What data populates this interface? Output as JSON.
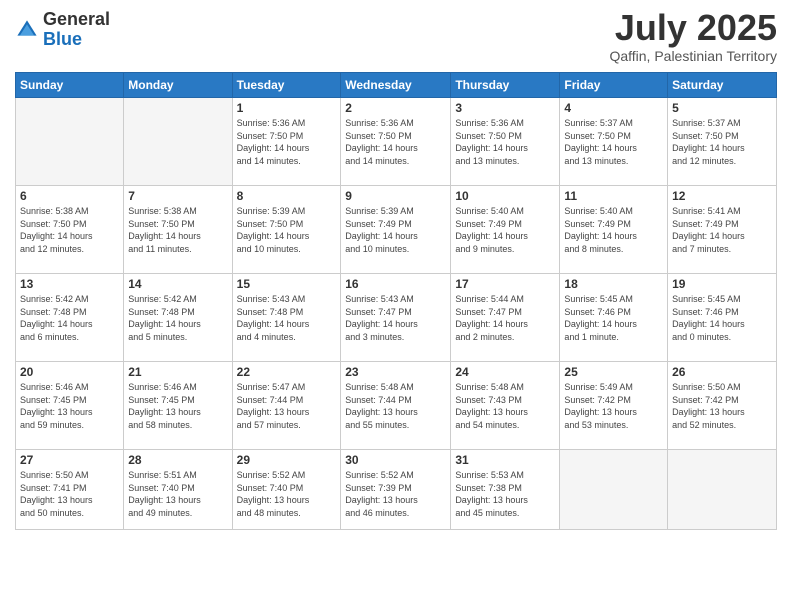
{
  "logo": {
    "general": "General",
    "blue": "Blue"
  },
  "header": {
    "month": "July 2025",
    "location": "Qaffin, Palestinian Territory"
  },
  "weekdays": [
    "Sunday",
    "Monday",
    "Tuesday",
    "Wednesday",
    "Thursday",
    "Friday",
    "Saturday"
  ],
  "weeks": [
    [
      {
        "day": "",
        "info": ""
      },
      {
        "day": "",
        "info": ""
      },
      {
        "day": "1",
        "info": "Sunrise: 5:36 AM\nSunset: 7:50 PM\nDaylight: 14 hours\nand 14 minutes."
      },
      {
        "day": "2",
        "info": "Sunrise: 5:36 AM\nSunset: 7:50 PM\nDaylight: 14 hours\nand 14 minutes."
      },
      {
        "day": "3",
        "info": "Sunrise: 5:36 AM\nSunset: 7:50 PM\nDaylight: 14 hours\nand 13 minutes."
      },
      {
        "day": "4",
        "info": "Sunrise: 5:37 AM\nSunset: 7:50 PM\nDaylight: 14 hours\nand 13 minutes."
      },
      {
        "day": "5",
        "info": "Sunrise: 5:37 AM\nSunset: 7:50 PM\nDaylight: 14 hours\nand 12 minutes."
      }
    ],
    [
      {
        "day": "6",
        "info": "Sunrise: 5:38 AM\nSunset: 7:50 PM\nDaylight: 14 hours\nand 12 minutes."
      },
      {
        "day": "7",
        "info": "Sunrise: 5:38 AM\nSunset: 7:50 PM\nDaylight: 14 hours\nand 11 minutes."
      },
      {
        "day": "8",
        "info": "Sunrise: 5:39 AM\nSunset: 7:50 PM\nDaylight: 14 hours\nand 10 minutes."
      },
      {
        "day": "9",
        "info": "Sunrise: 5:39 AM\nSunset: 7:49 PM\nDaylight: 14 hours\nand 10 minutes."
      },
      {
        "day": "10",
        "info": "Sunrise: 5:40 AM\nSunset: 7:49 PM\nDaylight: 14 hours\nand 9 minutes."
      },
      {
        "day": "11",
        "info": "Sunrise: 5:40 AM\nSunset: 7:49 PM\nDaylight: 14 hours\nand 8 minutes."
      },
      {
        "day": "12",
        "info": "Sunrise: 5:41 AM\nSunset: 7:49 PM\nDaylight: 14 hours\nand 7 minutes."
      }
    ],
    [
      {
        "day": "13",
        "info": "Sunrise: 5:42 AM\nSunset: 7:48 PM\nDaylight: 14 hours\nand 6 minutes."
      },
      {
        "day": "14",
        "info": "Sunrise: 5:42 AM\nSunset: 7:48 PM\nDaylight: 14 hours\nand 5 minutes."
      },
      {
        "day": "15",
        "info": "Sunrise: 5:43 AM\nSunset: 7:48 PM\nDaylight: 14 hours\nand 4 minutes."
      },
      {
        "day": "16",
        "info": "Sunrise: 5:43 AM\nSunset: 7:47 PM\nDaylight: 14 hours\nand 3 minutes."
      },
      {
        "day": "17",
        "info": "Sunrise: 5:44 AM\nSunset: 7:47 PM\nDaylight: 14 hours\nand 2 minutes."
      },
      {
        "day": "18",
        "info": "Sunrise: 5:45 AM\nSunset: 7:46 PM\nDaylight: 14 hours\nand 1 minute."
      },
      {
        "day": "19",
        "info": "Sunrise: 5:45 AM\nSunset: 7:46 PM\nDaylight: 14 hours\nand 0 minutes."
      }
    ],
    [
      {
        "day": "20",
        "info": "Sunrise: 5:46 AM\nSunset: 7:45 PM\nDaylight: 13 hours\nand 59 minutes."
      },
      {
        "day": "21",
        "info": "Sunrise: 5:46 AM\nSunset: 7:45 PM\nDaylight: 13 hours\nand 58 minutes."
      },
      {
        "day": "22",
        "info": "Sunrise: 5:47 AM\nSunset: 7:44 PM\nDaylight: 13 hours\nand 57 minutes."
      },
      {
        "day": "23",
        "info": "Sunrise: 5:48 AM\nSunset: 7:44 PM\nDaylight: 13 hours\nand 55 minutes."
      },
      {
        "day": "24",
        "info": "Sunrise: 5:48 AM\nSunset: 7:43 PM\nDaylight: 13 hours\nand 54 minutes."
      },
      {
        "day": "25",
        "info": "Sunrise: 5:49 AM\nSunset: 7:42 PM\nDaylight: 13 hours\nand 53 minutes."
      },
      {
        "day": "26",
        "info": "Sunrise: 5:50 AM\nSunset: 7:42 PM\nDaylight: 13 hours\nand 52 minutes."
      }
    ],
    [
      {
        "day": "27",
        "info": "Sunrise: 5:50 AM\nSunset: 7:41 PM\nDaylight: 13 hours\nand 50 minutes."
      },
      {
        "day": "28",
        "info": "Sunrise: 5:51 AM\nSunset: 7:40 PM\nDaylight: 13 hours\nand 49 minutes."
      },
      {
        "day": "29",
        "info": "Sunrise: 5:52 AM\nSunset: 7:40 PM\nDaylight: 13 hours\nand 48 minutes."
      },
      {
        "day": "30",
        "info": "Sunrise: 5:52 AM\nSunset: 7:39 PM\nDaylight: 13 hours\nand 46 minutes."
      },
      {
        "day": "31",
        "info": "Sunrise: 5:53 AM\nSunset: 7:38 PM\nDaylight: 13 hours\nand 45 minutes."
      },
      {
        "day": "",
        "info": ""
      },
      {
        "day": "",
        "info": ""
      }
    ]
  ]
}
